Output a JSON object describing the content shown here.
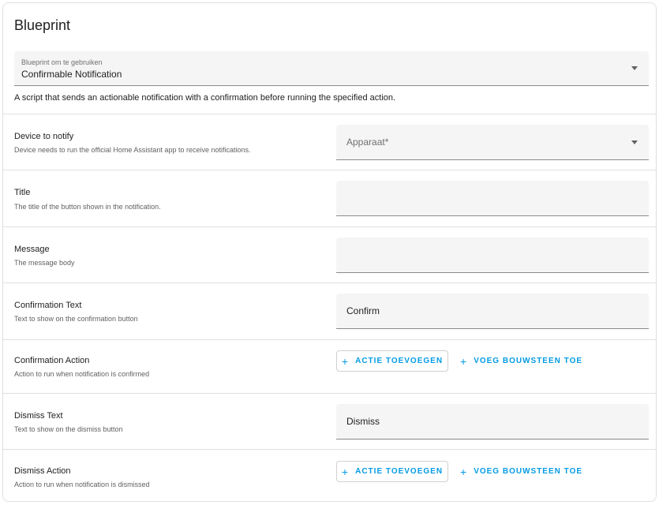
{
  "card": {
    "title": "Blueprint"
  },
  "blueprint_select": {
    "label": "Blueprint om te gebruiken",
    "value": "Confirmable Notification",
    "icon": "chevron-down-icon"
  },
  "description": "A script that sends an actionable notification with a confirmation before running the specified action.",
  "rows": [
    {
      "label": "Device to notify",
      "hint": "Device needs to run the official Home Assistant app to receive notifications.",
      "placeholder": "Apparaat*"
    },
    {
      "label": "Title",
      "hint": "The title of the button shown in the notification.",
      "value": ""
    },
    {
      "label": "Message",
      "hint": "The message body",
      "value": ""
    },
    {
      "label": "Confirmation Text",
      "hint": "Text to show on the confirmation button",
      "value": "Confirm"
    },
    {
      "label": "Confirmation Action",
      "hint": "Action to run when notification is confirmed",
      "add_action": "ACTIE TOEVOEGEN",
      "add_block": "VOEG BOUWSTEEN TOE"
    },
    {
      "label": "Dismiss Text",
      "hint": "Text to show on the dismiss button",
      "value": "Dismiss"
    },
    {
      "label": "Dismiss Action",
      "hint": "Action to run when notification is dismissed",
      "add_action": "ACTIE TOEVOEGEN",
      "add_block": "VOEG BOUWSTEEN TOE"
    }
  ],
  "plus_glyph": "+",
  "colors": {
    "accent": "#039be5",
    "field_bg": "#f5f5f5",
    "divider": "#e0e0e0"
  }
}
